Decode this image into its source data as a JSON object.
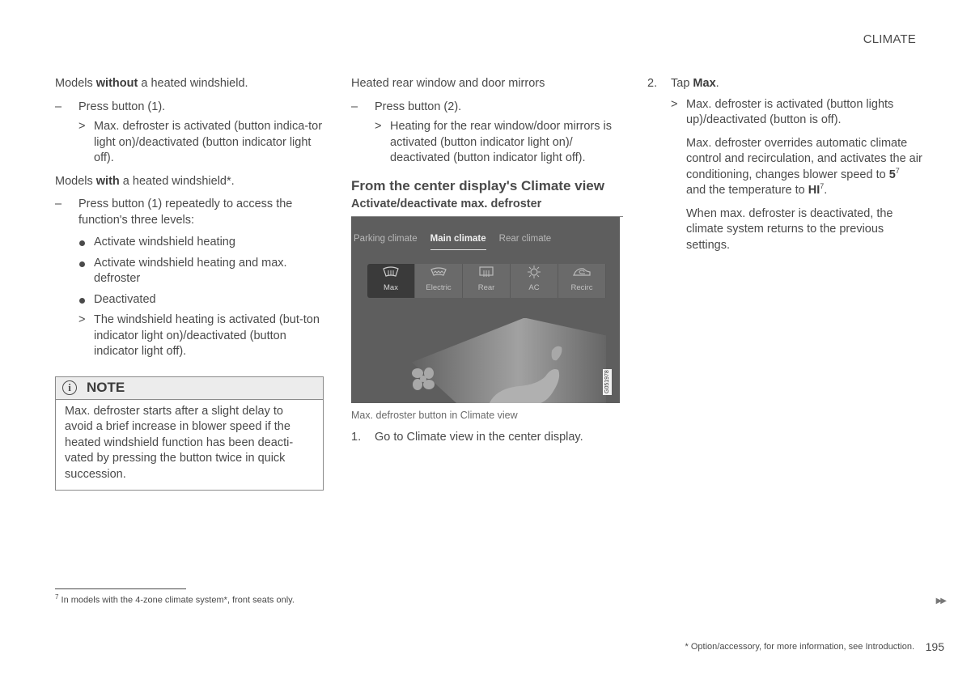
{
  "header": {
    "section": "CLIMATE"
  },
  "column1": {
    "intro_without_pre": "Models ",
    "intro_without_bold": "without",
    "intro_without_post": " a heated windshield.",
    "step1": "Press button (1).",
    "result1": "Max. defroster is activated (button indica-tor light on)/deactivated (button indicator light off).",
    "intro_with_pre": "Models ",
    "intro_with_bold": "with",
    "intro_with_post": " a heated windshield*.",
    "step2": "Press button (1) repeatedly to access the function's three levels:",
    "bullets": [
      "Activate windshield heating",
      "Activate windshield heating and max. defroster",
      "Deactivated"
    ],
    "result2": "The windshield heating is activated (but-ton indicator light on)/deactivated (button indicator light off).",
    "note": {
      "title": "NOTE",
      "icon": "info-icon",
      "body": "Max. defroster starts after a slight delay to avoid a brief increase in blower speed if the heated windshield function has been deacti-vated by pressing the button twice in quick succession."
    }
  },
  "column2": {
    "intro": "Heated rear window and door mirrors",
    "step": "Press button (2).",
    "result": "Heating for the rear window/door mirrors is activated (button indicator light on)/ deactivated (button indicator light off).",
    "heading": "From the center display's Climate view",
    "subheading": "Activate/deactivate max. defroster",
    "figure": {
      "tabs": [
        "Parking climate",
        "Main climate",
        "Rear climate"
      ],
      "active_tab": "Main climate",
      "buttons": [
        {
          "label": "Max",
          "icon": "max-defrost-icon",
          "active": true
        },
        {
          "label": "Electric",
          "icon": "electric-windshield-icon",
          "active": false
        },
        {
          "label": "Rear",
          "icon": "rear-defrost-icon",
          "active": false
        },
        {
          "label": "AC",
          "icon": "ac-snowflake-icon",
          "active": false
        },
        {
          "label": "Recirc",
          "icon": "recirculation-icon",
          "active": false
        }
      ],
      "code": "G051978"
    },
    "caption": "Max. defroster button in Climate view",
    "numbered_step_num": "1.",
    "numbered_step": "Go to Climate view in the center display."
  },
  "column3": {
    "step_num": "2.",
    "step_pre": "Tap ",
    "step_bold": "Max",
    "step_post": ".",
    "result": "Max. defroster is activated (button lights up)/deactivated (button is off).",
    "para1_a": "Max. defroster overrides automatic climate control and recirculation, and activates the air conditioning, changes blower speed to ",
    "para1_speed": "5",
    "para1_fn1": "7",
    "para1_b": " and the temperature to ",
    "para1_temp": "HI",
    "para1_fn2": "7",
    "para1_c": ".",
    "para2": "When max. defroster is deactivated, the climate system returns to the previous settings."
  },
  "footer": {
    "footnote_num": "7",
    "footnote_text": " In models with the 4-zone climate system*, front seats only.",
    "continue_marker": "▶▶",
    "option_note": "* Option/accessory, for more information, see Introduction.",
    "page_number": "195"
  }
}
